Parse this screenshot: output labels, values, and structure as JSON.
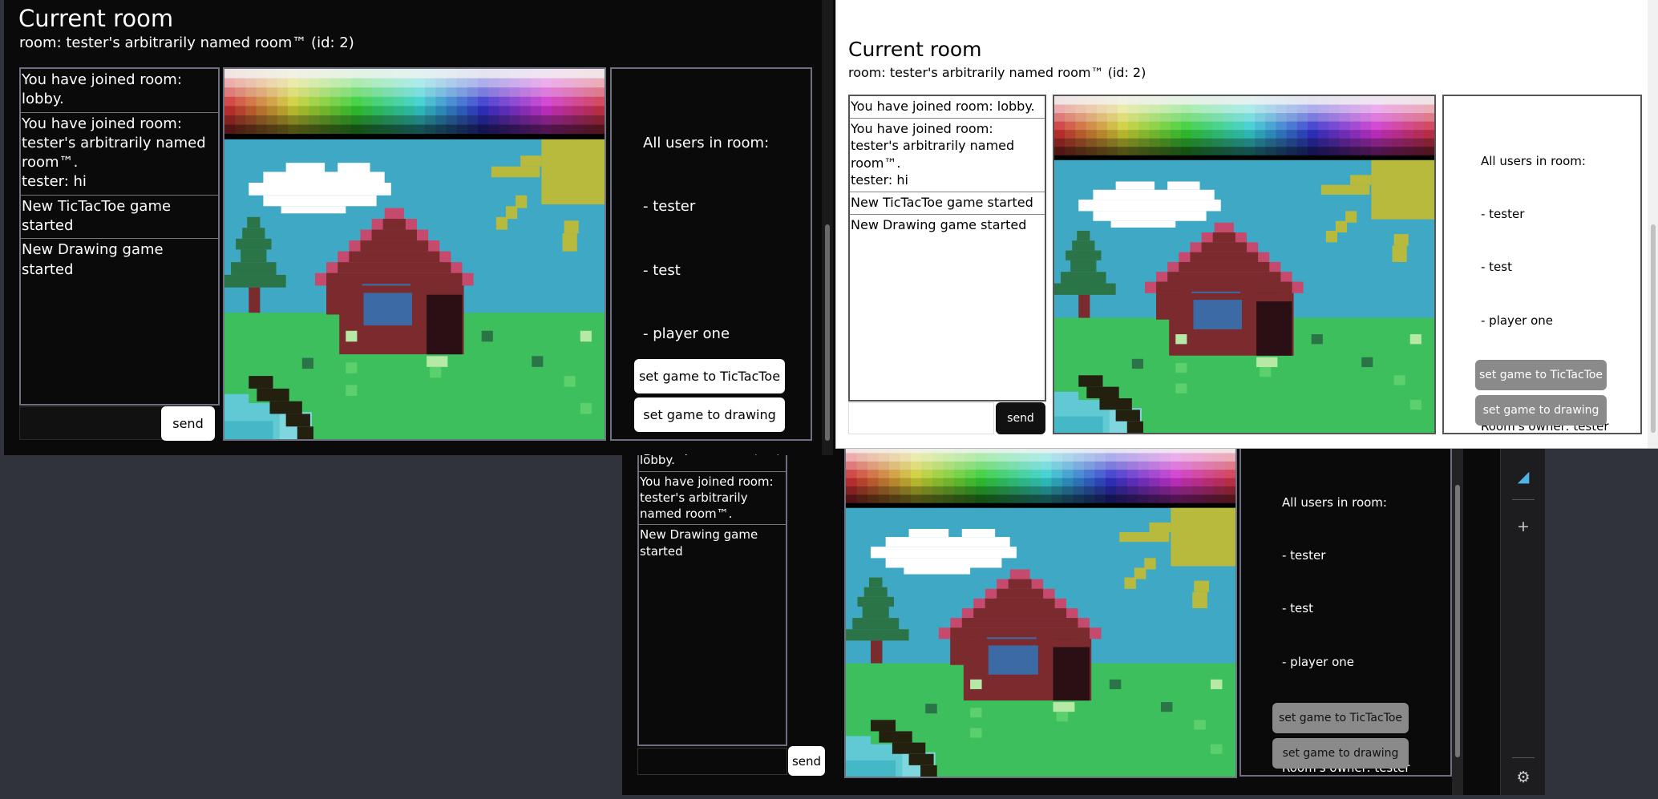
{
  "room": {
    "heading": "Current room",
    "subtitle": "room: tester's arbitrarily named room™ (id: 2)"
  },
  "chat_full": [
    "You have joined room: lobby.",
    "You have joined room: tester's arbitrarily named room™.\ntester: hi",
    "New TicTacToe game started",
    "New Drawing game started"
  ],
  "chat_partial": {
    "clipped_first": "You have joined room: lobby.",
    "items": [
      "You have joined room: tester's arbitrarily named room™.",
      "New Drawing game started"
    ]
  },
  "send_label": "send",
  "users": {
    "title": "All users in room:",
    "list": [
      "- tester",
      "- test",
      "- player one"
    ],
    "owner": "Room's owner: tester"
  },
  "buttons": {
    "tictactoe": "set game to TicTacToe",
    "drawing": "set game to drawing"
  },
  "sidebar_icons": [
    "edge-shopping-icon",
    "add-icon",
    "settings-icon"
  ],
  "colors": {
    "sky": "#3fa9c5",
    "grass": "#3cbf5c",
    "house": "#7b2b2e",
    "roof": "#c64a6e",
    "sun": "#b7ba3c",
    "tree": "#2a7448"
  }
}
